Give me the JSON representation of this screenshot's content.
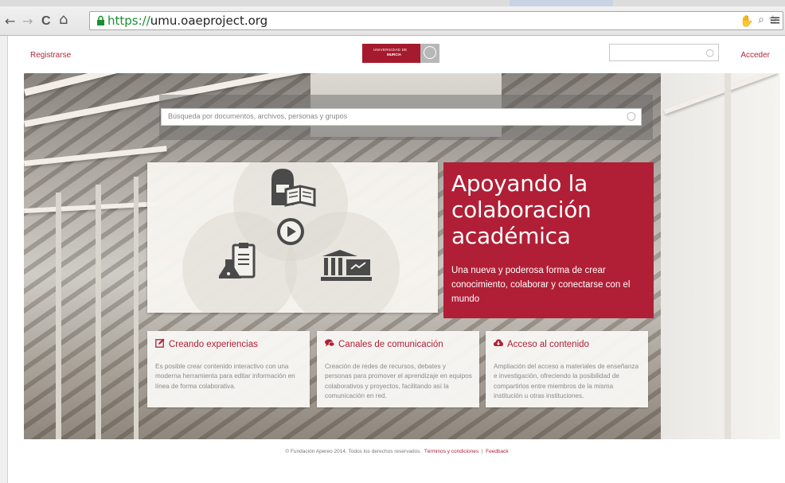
{
  "browser": {
    "url_scheme": "https://",
    "url_rest": "umu.oaeproject.org",
    "back_icon": "arrow-left-icon",
    "forward_icon": "arrow-right-icon",
    "reload_icon": "reload-icon",
    "home_icon": "home-icon",
    "back_glyph": "←",
    "forward_glyph": "→",
    "reload_glyph": "C",
    "home_glyph": "⌂",
    "zoom_glyph": "🔍︎",
    "star_glyph": "☆",
    "menu_glyph": "≡",
    "ext_glyph": "✋"
  },
  "header": {
    "register_label": "Registrarse",
    "login_label": "Acceder",
    "logo_line1": "UNIVERSIDAD DE",
    "logo_line2": "MURCIA",
    "search_value": "",
    "brand_color": "#b01f36"
  },
  "hero": {
    "search_placeholder": "Búsqueda por documentos, archivos, personas y grupos",
    "headline": "Apoyando la colaboración académica",
    "subtext": "Una nueva y poderosa forma de crear conocimiento, colaborar y conectarse con el mundo"
  },
  "features": [
    {
      "title": "Creando experiencias",
      "icon": "edit-icon",
      "description": "Es posible crear contenido interactivo con una moderna herramienta para editar información en línea de forma colaborativa."
    },
    {
      "title": "Canales de comunicación",
      "icon": "chat-icon",
      "description": "Creación de redes de recursos, debates y personas para promover el aprendizaje en equipos colaborativos y proyectos, facilitando así la comunicación en red."
    },
    {
      "title": "Acceso al contenido",
      "icon": "cloud-download-icon",
      "description": "Ampliación del acceso a materiales de enseñanza e investigación, ofreciendo la posibilidad de compartirlos entre miembros de la misma institución u otras instituciones."
    }
  ],
  "footer": {
    "copyright": "© Fundación Apereo 2014. Todos los derechos reservados.",
    "terms_label": "Términos y condiciones",
    "separator": "|",
    "feedback_label": "Feedback"
  }
}
